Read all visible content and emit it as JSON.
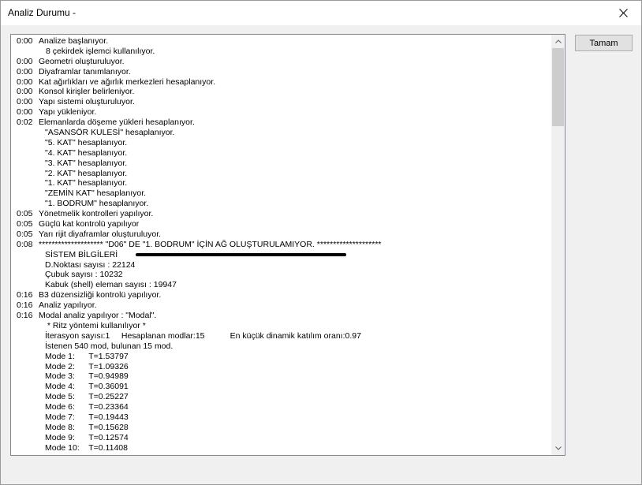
{
  "window": {
    "title": "Analiz Durumu -",
    "close_glyph": "close-icon"
  },
  "ok_button": {
    "label": "Tamam"
  },
  "log": [
    {
      "time": "0:00",
      "text": "Analize başlanıyor.",
      "indent": 0
    },
    {
      "time": "",
      "text": "8 çekirdek işlemci kullanılıyor.",
      "indent": 1
    },
    {
      "time": "0:00",
      "text": "Geometri oluşturuluyor.",
      "indent": 0
    },
    {
      "time": "0:00",
      "text": "Diyaframlar tanımlanıyor.",
      "indent": 0
    },
    {
      "time": "0:00",
      "text": "Kat ağırlıkları ve ağırlık merkezleri hesaplanıyor.",
      "indent": 0
    },
    {
      "time": "0:00",
      "text": "Konsol kirişler belirleniyor.",
      "indent": 0
    },
    {
      "time": "0:00",
      "text": "Yapı sistemi oluşturuluyor.",
      "indent": 0
    },
    {
      "time": "0:00",
      "text": "Yapı yükleniyor.",
      "indent": 0
    },
    {
      "time": "0:02",
      "text": "Elemanlarda döşeme yükleri hesaplanıyor.",
      "indent": 0
    },
    {
      "time": "",
      "text": "\"ASANSÖR KULESİ\" hesaplanıyor.",
      "indent": 2
    },
    {
      "time": "",
      "text": "\"5. KAT\" hesaplanıyor.",
      "indent": 2
    },
    {
      "time": "",
      "text": "\"4. KAT\" hesaplanıyor.",
      "indent": 2
    },
    {
      "time": "",
      "text": "\"3. KAT\" hesaplanıyor.",
      "indent": 2
    },
    {
      "time": "",
      "text": "\"2. KAT\" hesaplanıyor.",
      "indent": 2
    },
    {
      "time": "",
      "text": "\"1. KAT\" hesaplanıyor.",
      "indent": 2
    },
    {
      "time": "",
      "text": "\"ZEMİN KAT\" hesaplanıyor.",
      "indent": 2
    },
    {
      "time": "",
      "text": "\"1. BODRUM\" hesaplanıyor.",
      "indent": 2
    },
    {
      "time": "0:05",
      "text": "Yönetmelik kontrolleri yapılıyor.",
      "indent": 0
    },
    {
      "time": "0:05",
      "text": "Güçlü kat kontrolü yapılıyor",
      "indent": 0
    },
    {
      "time": "0:05",
      "text": "Yarı rijit diyaframlar oluşturuluyor.",
      "indent": 0
    },
    {
      "time": "0:08",
      "text": "******************** \"D06\" DE \"1. BODRUM\" İÇİN AĞ OLUŞTURULAMIYOR. ********************",
      "indent": 0
    },
    {
      "time": "",
      "text": "SİSTEM BİLGİLERİ",
      "indent": 2
    },
    {
      "time": "",
      "text": "D.Noktası sayısı : 22124",
      "indent": 2
    },
    {
      "time": "",
      "text": "Çubuk sayısı : 10232",
      "indent": 2
    },
    {
      "time": "",
      "text": "Kabuk (shell) eleman sayısı : 19947",
      "indent": 2
    },
    {
      "time": "0:16",
      "text": "B3 düzensizliği kontrolü yapılıyor.",
      "indent": 0
    },
    {
      "time": "0:16",
      "text": "Analiz yapılıyor.",
      "indent": 0
    },
    {
      "time": "0:16",
      "text": "Modal analiz yapılıyor : \"Modal\".",
      "indent": 0
    },
    {
      "time": "",
      "text": " * Ritz yöntemi kullanılıyor *",
      "indent": 2
    },
    {
      "time": "",
      "text": "İterasyon sayısı:1     Hesaplanan modlar:15           En küçük dinamik katılım oranı:0.97",
      "indent": 2
    },
    {
      "time": "",
      "text": "İstenen 540 mod, bulunan 15 mod.",
      "indent": 2
    },
    {
      "time": "",
      "text": "Mode 1:      T=1.53797",
      "indent": 2
    },
    {
      "time": "",
      "text": "Mode 2:      T=1.09326",
      "indent": 2
    },
    {
      "time": "",
      "text": "Mode 3:      T=0.94989",
      "indent": 2
    },
    {
      "time": "",
      "text": "Mode 4:      T=0.36091",
      "indent": 2
    },
    {
      "time": "",
      "text": "Mode 5:      T=0.25227",
      "indent": 2
    },
    {
      "time": "",
      "text": "Mode 6:      T=0.23364",
      "indent": 2
    },
    {
      "time": "",
      "text": "Mode 7:      T=0.19443",
      "indent": 2
    },
    {
      "time": "",
      "text": "Mode 8:      T=0.15628",
      "indent": 2
    },
    {
      "time": "",
      "text": "Mode 9:      T=0.12574",
      "indent": 2
    },
    {
      "time": "",
      "text": "Mode 10:    T=0.11408",
      "indent": 2
    }
  ],
  "colors": {
    "window_bg": "#f0f0f0",
    "log_bg": "#ffffff",
    "scroll_thumb": "#cdcdcd",
    "button_bg": "#e1e1e1",
    "annotation_stroke": "#000000"
  }
}
